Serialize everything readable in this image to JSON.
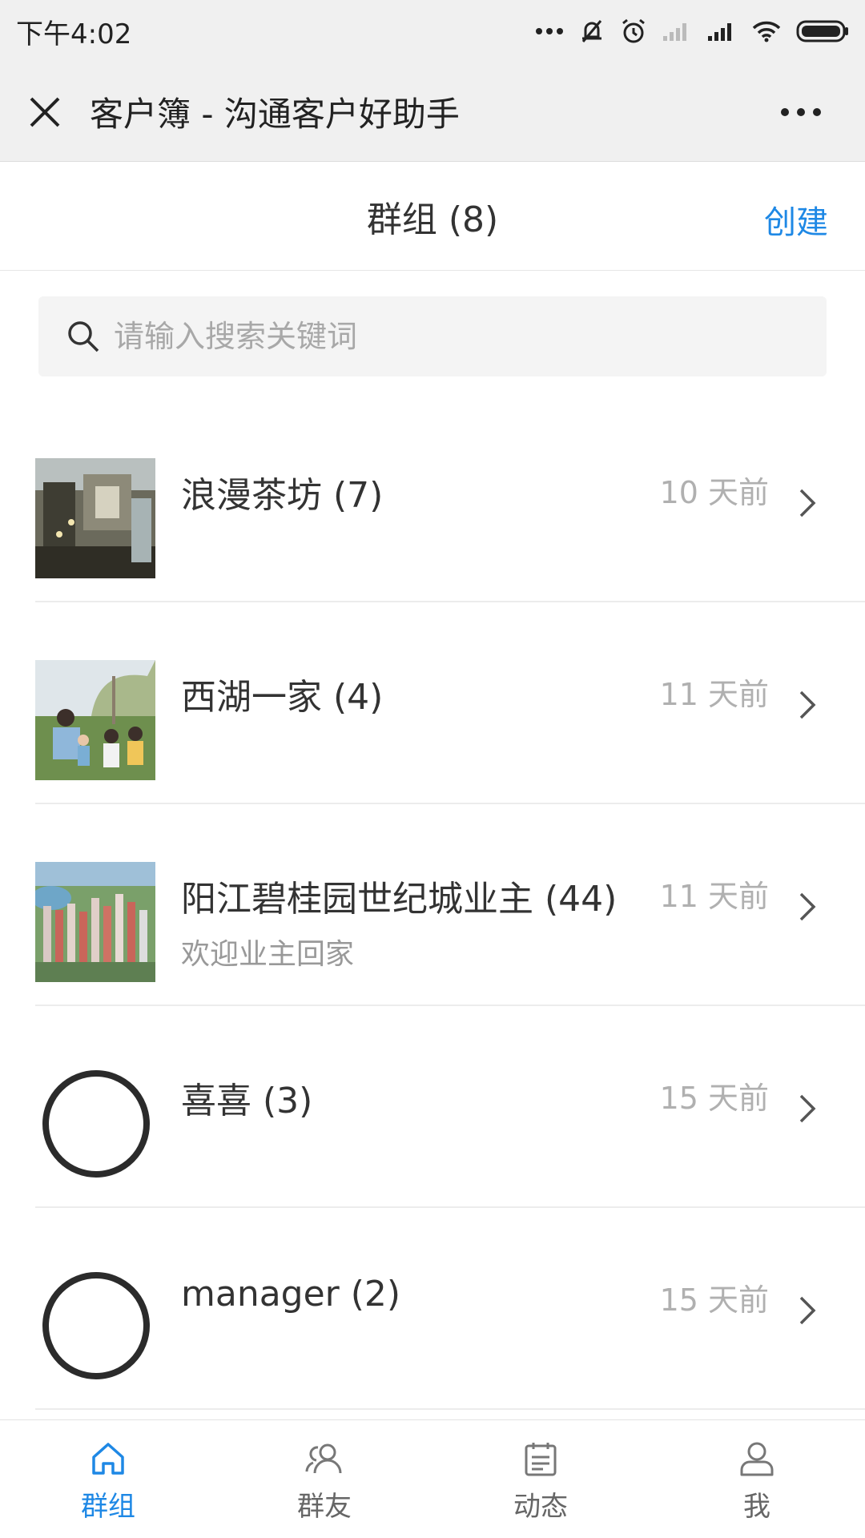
{
  "status_bar": {
    "time": "下午4:02"
  },
  "nav": {
    "title": "客户簿 - 沟通客户好助手"
  },
  "header": {
    "title": "群组 (8)",
    "create_label": "创建"
  },
  "search": {
    "placeholder": "请输入搜索关键词"
  },
  "groups": [
    {
      "name": "浪漫茶坊 (7)",
      "time": "10 天前",
      "subtitle": "",
      "avatar": "photo-tea-house"
    },
    {
      "name": "西湖一家 (4)",
      "time": "11 天前",
      "subtitle": "",
      "avatar": "photo-family"
    },
    {
      "name": "阳江碧桂园世纪城业主 (44)",
      "time": "11 天前",
      "subtitle": "欢迎业主回家",
      "avatar": "photo-city"
    },
    {
      "name": "喜喜 (3)",
      "time": "15 天前",
      "subtitle": "",
      "avatar": "circle-placeholder"
    },
    {
      "name": "manager (2)",
      "time": "15 天前",
      "subtitle": "",
      "avatar": "circle-placeholder"
    }
  ],
  "tabs": [
    {
      "label": "群组",
      "icon": "home-icon",
      "active": true
    },
    {
      "label": "群友",
      "icon": "people-icon",
      "active": false
    },
    {
      "label": "动态",
      "icon": "notes-icon",
      "active": false
    },
    {
      "label": "我",
      "icon": "user-icon",
      "active": false
    }
  ],
  "colors": {
    "accent": "#1e88e5",
    "bar_bg": "#f0f0f0",
    "muted": "#b0b0b0"
  }
}
